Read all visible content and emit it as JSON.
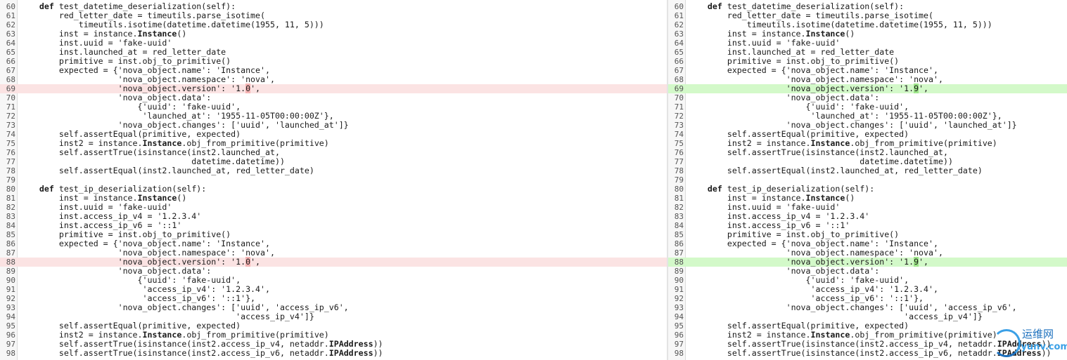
{
  "diff": {
    "lines": [
      {
        "n": "60",
        "t": "    def test_datetime_deserialization(self):"
      },
      {
        "n": "61",
        "t": "        red_letter_date = timeutils.parse_isotime("
      },
      {
        "n": "62",
        "t": "            timeutils.isotime(datetime.datetime(1955, 11, 5)))"
      },
      {
        "n": "63",
        "t": "        inst = instance.Instance()"
      },
      {
        "n": "64",
        "t": "        inst.uuid = 'fake-uuid'"
      },
      {
        "n": "65",
        "t": "        inst.launched_at = red_letter_date"
      },
      {
        "n": "66",
        "t": "        primitive = inst.obj_to_primitive()"
      },
      {
        "n": "67",
        "t": "        expected = {'nova_object.name': 'Instance',"
      },
      {
        "n": "68",
        "t": "                    'nova_object.namespace': 'nova',"
      },
      {
        "n": "69",
        "l_pre": "                    'nova_object.version': '1.",
        "l_hl": "0",
        "l_post": "',",
        "r_pre": "                    'nova_object.version': '1.",
        "r_hl": "9",
        "r_post": "',",
        "changed": true
      },
      {
        "n": "70",
        "t": "                    'nova_object.data':"
      },
      {
        "n": "71",
        "t": "                        {'uuid': 'fake-uuid',"
      },
      {
        "n": "72",
        "t": "                         'launched_at': '1955-11-05T00:00:00Z'},"
      },
      {
        "n": "73",
        "t": "                    'nova_object.changes': ['uuid', 'launched_at']}"
      },
      {
        "n": "74",
        "t": "        self.assertEqual(primitive, expected)"
      },
      {
        "n": "75",
        "t": "        inst2 = instance.Instance.obj_from_primitive(primitive)"
      },
      {
        "n": "76",
        "t": "        self.assertTrue(isinstance(inst2.launched_at,"
      },
      {
        "n": "77",
        "t": "                                   datetime.datetime))"
      },
      {
        "n": "78",
        "t": "        self.assertEqual(inst2.launched_at, red_letter_date)"
      },
      {
        "n": "79",
        "t": ""
      },
      {
        "n": "80",
        "t": "    def test_ip_deserialization(self):"
      },
      {
        "n": "81",
        "t": "        inst = instance.Instance()"
      },
      {
        "n": "82",
        "t": "        inst.uuid = 'fake-uuid'"
      },
      {
        "n": "83",
        "t": "        inst.access_ip_v4 = '1.2.3.4'"
      },
      {
        "n": "84",
        "t": "        inst.access_ip_v6 = '::1'"
      },
      {
        "n": "85",
        "t": "        primitive = inst.obj_to_primitive()"
      },
      {
        "n": "86",
        "t": "        expected = {'nova_object.name': 'Instance',"
      },
      {
        "n": "87",
        "t": "                    'nova_object.namespace': 'nova',"
      },
      {
        "n": "88",
        "l_pre": "                    'nova_object.version': '1.",
        "l_hl": "0",
        "l_post": "',",
        "r_pre": "                    'nova_object.version': '1.",
        "r_hl": "9",
        "r_post": "',",
        "changed": true
      },
      {
        "n": "89",
        "t": "                    'nova_object.data':"
      },
      {
        "n": "90",
        "t": "                        {'uuid': 'fake-uuid',"
      },
      {
        "n": "91",
        "t": "                         'access_ip_v4': '1.2.3.4',"
      },
      {
        "n": "92",
        "t": "                         'access_ip_v6': '::1'},"
      },
      {
        "n": "93",
        "t": "                    'nova_object.changes': ['uuid', 'access_ip_v6',"
      },
      {
        "n": "94",
        "t": "                                            'access_ip_v4']}"
      },
      {
        "n": "95",
        "t": "        self.assertEqual(primitive, expected)"
      },
      {
        "n": "96",
        "t": "        inst2 = instance.Instance.obj_from_primitive(primitive)"
      },
      {
        "n": "97",
        "t": "        self.assertTrue(isinstance(inst2.access_ip_v4, netaddr.IPAddress))"
      },
      {
        "n": "98",
        "t": "        self.assertTrue(isinstance(inst2.access_ip_v6, netaddr.IPAddress))"
      }
    ]
  },
  "colors": {
    "deleted_line_bg": "#fbe3e3",
    "deleted_char_bg": "#f5b3b3",
    "added_line_bg": "#d3f9c9",
    "added_char_bg": "#9ee68a"
  },
  "watermark": {
    "icon": "logo-swirl-icon",
    "line1": "运维网",
    "line2": "iyunv.com"
  }
}
